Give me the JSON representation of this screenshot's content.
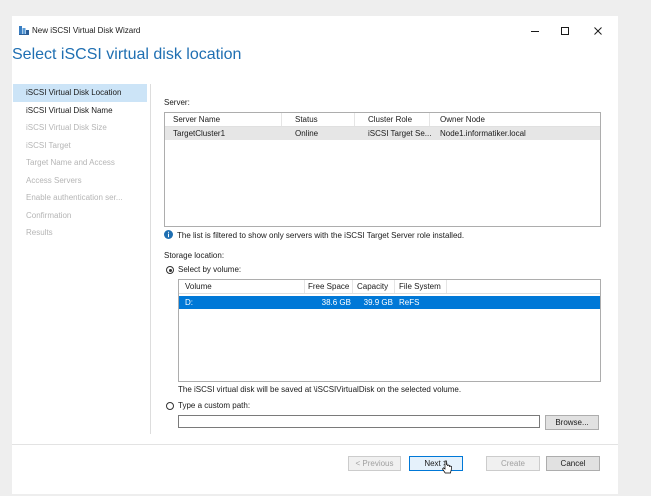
{
  "window": {
    "title": "New iSCSI Virtual Disk Wizard"
  },
  "header": {
    "title": "Select iSCSI virtual disk location"
  },
  "nav": {
    "items": [
      {
        "label": "iSCSI Virtual Disk Location",
        "state": "active"
      },
      {
        "label": "iSCSI Virtual Disk Name",
        "state": "enabled"
      },
      {
        "label": "iSCSI Virtual Disk Size",
        "state": "disabled"
      },
      {
        "label": "iSCSI Target",
        "state": "disabled"
      },
      {
        "label": "Target Name and Access",
        "state": "disabled"
      },
      {
        "label": "Access Servers",
        "state": "disabled"
      },
      {
        "label": "Enable authentication ser...",
        "state": "disabled"
      },
      {
        "label": "Confirmation",
        "state": "disabled"
      },
      {
        "label": "Results",
        "state": "disabled"
      }
    ]
  },
  "server": {
    "label": "Server:",
    "columns": [
      "Server Name",
      "Status",
      "Cluster Role",
      "Owner Node"
    ],
    "rows": [
      {
        "server_name": "TargetCluster1",
        "status": "Online",
        "cluster_role": "iSCSI Target Se...",
        "owner_node": "Node1.informatiker.local"
      }
    ],
    "filter_note": "The list is filtered to show only servers with the iSCSI Target Server role installed."
  },
  "storage": {
    "label": "Storage location:",
    "by_volume_label": "Select by volume:",
    "volume_columns": [
      "Volume",
      "Free Space",
      "Capacity",
      "File System"
    ],
    "volumes": [
      {
        "volume": "D:",
        "free_space": "38.6 GB",
        "capacity": "39.9 GB",
        "file_system": "ReFS"
      }
    ],
    "save_note": "The iSCSI virtual disk will be saved at \\iSCSIVirtualDisk on the selected volume.",
    "custom_path_label": "Type a custom path:",
    "custom_path_value": "",
    "browse_label": "Browse..."
  },
  "footer": {
    "previous_label": "< Previous",
    "next_label": "Next >",
    "create_label": "Create",
    "cancel_label": "Cancel"
  },
  "colors": {
    "accent": "#1f6fb2",
    "selection": "#0078d7",
    "nav_active": "#cce4f7"
  }
}
